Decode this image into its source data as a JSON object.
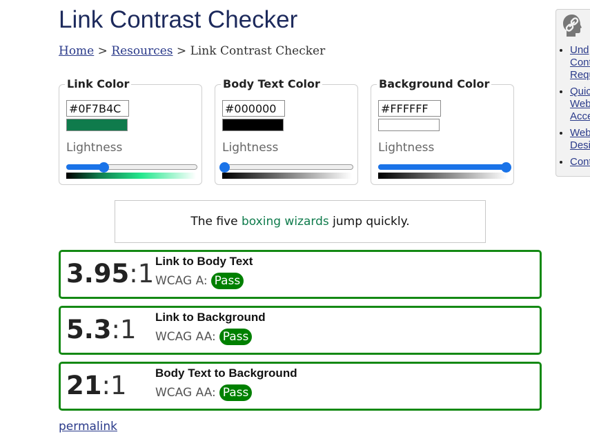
{
  "page": {
    "title": "Link Contrast Checker"
  },
  "breadcrumb": {
    "home": "Home",
    "sep1": ">",
    "resources": "Resources",
    "sep2": ">",
    "current": "Link Contrast Checker"
  },
  "panels": [
    {
      "legend": "Link Color",
      "hex": "#0F7B4C",
      "swatch_color": "#0F7B4C",
      "lightness_label": "Lightness",
      "lightness_value": 0.28
    },
    {
      "legend": "Body Text Color",
      "hex": "#000000",
      "swatch_color": "#000000",
      "lightness_label": "Lightness",
      "lightness_value": 0.0
    },
    {
      "legend": "Background Color",
      "hex": "#FFFFFF",
      "swatch_color": "#FFFFFF",
      "lightness_label": "Lightness",
      "lightness_value": 1.0
    }
  ],
  "sample": {
    "before": "The five ",
    "link": "boxing wizards",
    "after": " jump quickly."
  },
  "results": [
    {
      "ratio": "3.95",
      "suffix": ":1",
      "title": "Link to Body Text",
      "level": "WCAG A:",
      "badge": "Pass"
    },
    {
      "ratio": "5.3",
      "suffix": ":1",
      "title": "Link to Background",
      "level": "WCAG AA:",
      "badge": "Pass"
    },
    {
      "ratio": "21",
      "suffix": ":1",
      "title": "Body Text to Background",
      "level": "WCAG AA:",
      "badge": "Pass"
    }
  ],
  "permalink": "permalink",
  "sidebar": {
    "icon": "link-head-icon",
    "items": [
      "Und Cont Requ",
      "Quic Web Acce",
      "Web Desi",
      "Cont"
    ]
  },
  "colors": {
    "accent": "#1a73e8",
    "pass": "#008000",
    "result_border": "#148914",
    "link_text": "#2a3a8a"
  }
}
